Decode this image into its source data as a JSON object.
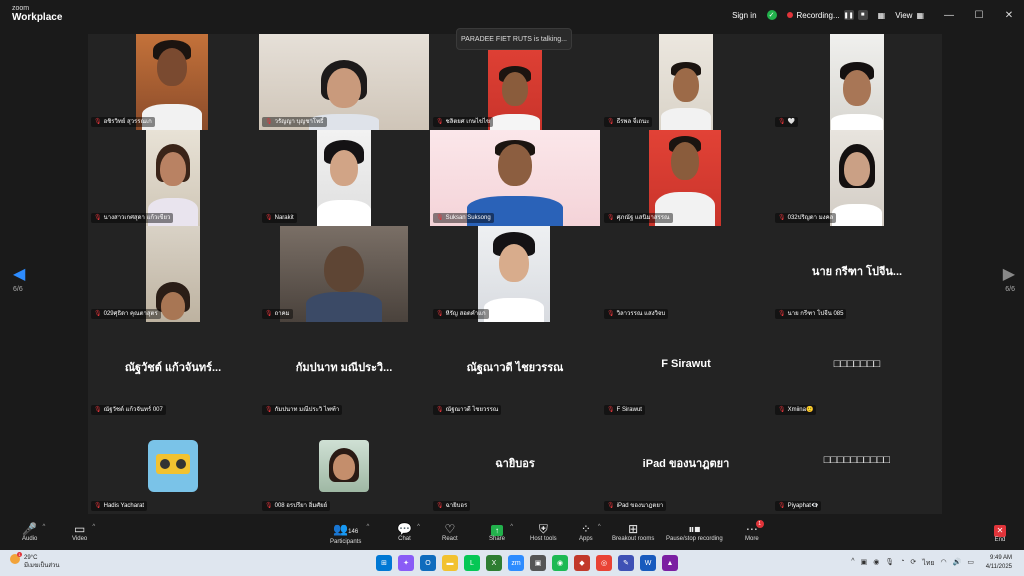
{
  "titlebar": {
    "logo_line1": "zoom",
    "logo_line2": "Workplace",
    "sign_in": "Sign in",
    "recording": "Recording...",
    "view": "View",
    "minimize": "—",
    "maximize": "☐",
    "close": "✕"
  },
  "talking_banner": "PARADEE FIET RUTS is talking...",
  "nav": {
    "prev": "◀",
    "next": "▶",
    "page": "6/6"
  },
  "tiles": [
    {
      "name": "อชิรวิทย์ สุวรรณเก"
    },
    {
      "name": "วรัญญา บุญชาโพธิ์"
    },
    {
      "name": "ชลิตยศ เกษไข่ไข"
    },
    {
      "name": "ธีรพล จี่เถนะ"
    },
    {
      "name": "🤍"
    },
    {
      "name": "นางสาวเกศสุดา แก้วเขียว"
    },
    {
      "name": "Narakit"
    },
    {
      "name": "Suksan Suksong"
    },
    {
      "name": "ศุภณัฐ แสนิมาสรรณ"
    },
    {
      "name": "032ปริญดา มงคล"
    },
    {
      "name": "029ศุธิดา คุณตาสุตร"
    },
    {
      "name": "ถาคม"
    },
    {
      "name": "หิรัญ สอดคำแก"
    },
    {
      "name": "วิลาวรรณ แสงวิจบ"
    },
    {
      "name": "นาย กรีฑา โปจีน 085",
      "big": "นาย กรีฑา โปจีน..."
    },
    {
      "name": "ณัฐวัชต์ แก้วจันทร์ 007",
      "big": "ณัฐวัชต์ แก้วจันทร์..."
    },
    {
      "name": "กัมปนาท มณีประวิ ไพฑ้า",
      "big": "กัมปนาท มณีประวิ..."
    },
    {
      "name": "ณัฐณาวดี ไชยวรรณ",
      "big": "ณัฐณาวดี ไชยวรรณ"
    },
    {
      "name": "F Sirawut",
      "big": "F  Sirawut"
    },
    {
      "name": "Xmiina🙂",
      "big": "□□□□□□□"
    },
    {
      "name": "Hadis Yacharat"
    },
    {
      "name": "008 อรปรียา อิ่มศัยย์"
    },
    {
      "name": "ฉายิบอร",
      "big": "ฉายิบอร"
    },
    {
      "name": "iPad ของนาฎตยา",
      "big": "iPad ของนาฎตยา"
    },
    {
      "name": "Piyaphat👁‍🗨",
      "big": "□□□□□□□□□□"
    }
  ],
  "toolbar": {
    "audio": "Audio",
    "video": "Video",
    "participants": "Participants",
    "participants_count": "146",
    "chat": "Chat",
    "react": "React",
    "share": "Share",
    "host_tools": "Host tools",
    "apps": "Apps",
    "breakout": "Breakout rooms",
    "pause_rec": "Pause/stop recording",
    "more": "More",
    "more_badge": "1",
    "end": "End"
  },
  "taskbar": {
    "temp": "29°C",
    "weather_text": "มีเมฆเป็นส่วน",
    "weather_badge": "1",
    "tray_lang": "ไทย",
    "time": "9:49 AM",
    "date": "4/11/2025"
  },
  "colors": {
    "accent": "#2d8cff",
    "danger": "#e0343a",
    "share": "#22b14c"
  }
}
